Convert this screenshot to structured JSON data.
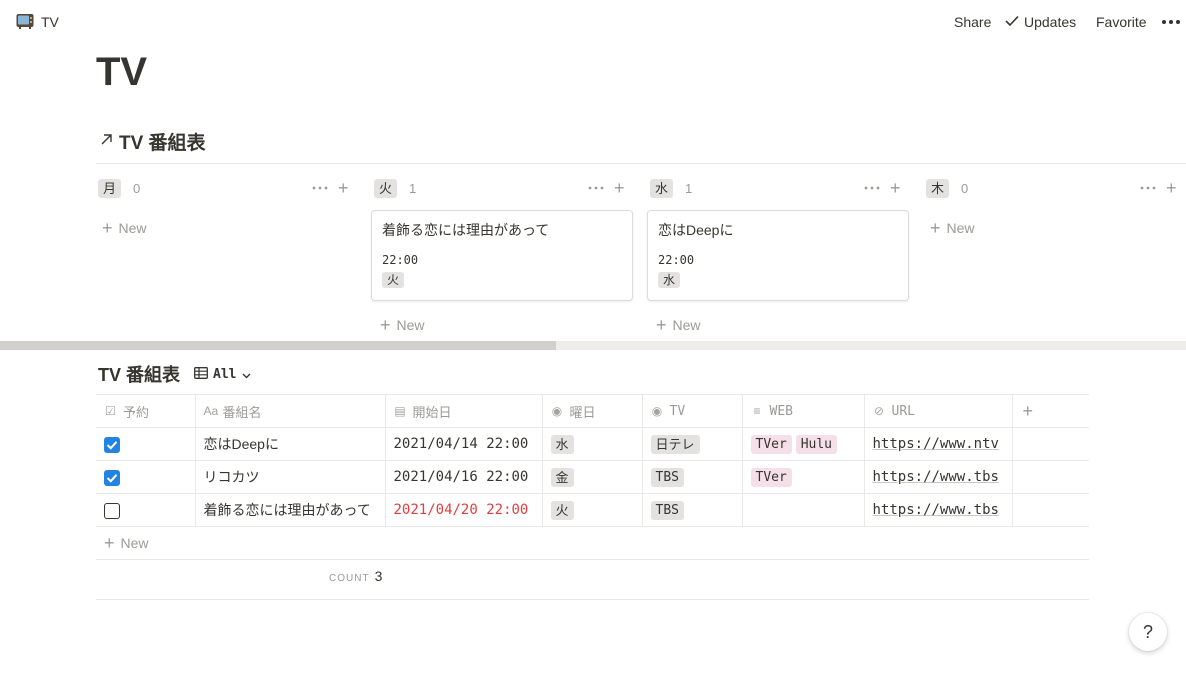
{
  "topbar": {
    "workspace_title": "TV",
    "share_label": "Share",
    "updates_label": "Updates",
    "favorite_label": "Favorite"
  },
  "page": {
    "title": "TV"
  },
  "linked_db": {
    "title": "TV 番組表"
  },
  "board": {
    "new_label": "New",
    "columns": [
      {
        "label": "月",
        "count": "0"
      },
      {
        "label": "火",
        "count": "1"
      },
      {
        "label": "水",
        "count": "1"
      },
      {
        "label": "木",
        "count": "0"
      }
    ],
    "cards": [
      {
        "title": "着飾る恋には理由があって",
        "time": "22:00",
        "day": "火"
      },
      {
        "title": "恋はDeepに",
        "time": "22:00",
        "day": "水"
      }
    ]
  },
  "table_view": {
    "title": "TV 番組表",
    "view_label": "All",
    "columns": [
      "予約",
      "番組名",
      "開始日",
      "曜日",
      "TV",
      "WEB",
      "URL"
    ],
    "rows": [
      {
        "reserved": true,
        "name": "恋はDeepに",
        "start": "2021/04/14 22:00",
        "day": "水",
        "tv": "日テレ",
        "web": [
          "TVer",
          "Hulu"
        ],
        "url": "https://www.ntv"
      },
      {
        "reserved": true,
        "name": "リコカツ",
        "start": "2021/04/16 22:00",
        "day": "金",
        "tv": "TBS",
        "web": [
          "TVer"
        ],
        "url": "https://www.tbs"
      },
      {
        "reserved": false,
        "name": "着飾る恋には理由があって",
        "start": "2021/04/20 22:00",
        "day": "火",
        "tv": "TBS",
        "web": [],
        "url": "https://www.tbs"
      }
    ],
    "new_label": "New",
    "count_label": "COUNT",
    "count_value": "3"
  },
  "help_label": "?",
  "colors": {
    "accent": "#2383e2",
    "overdue": "#e03e3e",
    "tag_gray": "#e3e2e0",
    "tag_pink": "#f5e0e9"
  }
}
